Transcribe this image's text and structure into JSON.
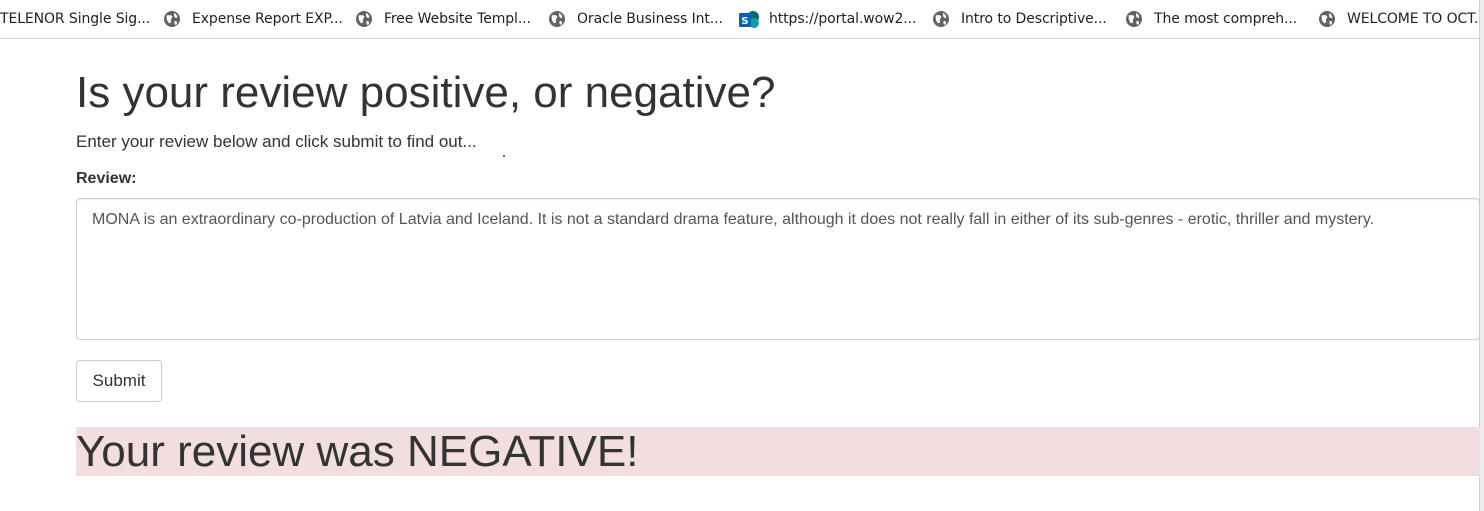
{
  "bookmarks": [
    {
      "label": "TELENOR Single Sig...",
      "icon": "none"
    },
    {
      "label": "Expense Report EXP...",
      "icon": "globe-icon"
    },
    {
      "label": "Free Website Templ...",
      "icon": "globe-icon"
    },
    {
      "label": "Oracle Business Int...",
      "icon": "globe-icon"
    },
    {
      "label": "https://portal.wow2...",
      "icon": "sharepoint-icon"
    },
    {
      "label": "Intro to Descriptive...",
      "icon": "globe-icon"
    },
    {
      "label": "The most compreh...",
      "icon": "globe-icon"
    },
    {
      "label": "WELCOME TO OCT...",
      "icon": "globe-icon"
    }
  ],
  "page": {
    "title": "Is your review positive, or negative?",
    "lead": "Enter your review below and click submit to find out...",
    "review_label": "Review:",
    "review_text": "MONA is an extraordinary co-production of Latvia and Iceland. It is not a standard drama feature, although it does not really fall in either of its sub-genres - erotic, thriller and mystery.",
    "submit_label": "Submit",
    "result": "Your review was NEGATIVE!"
  },
  "colors": {
    "result_background": "#f2dede",
    "text": "#333333",
    "sharepoint_blue": "#0364b8",
    "globe_gray": "#5f6368"
  }
}
